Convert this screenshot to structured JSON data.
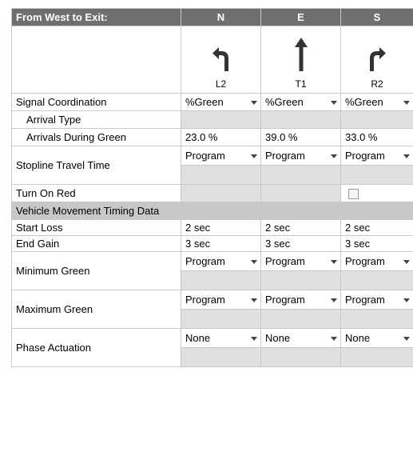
{
  "header": {
    "title": "From West to Exit:",
    "directions": [
      "N",
      "E",
      "S"
    ]
  },
  "movements": [
    {
      "label": "L2",
      "icon": "turn-left-arrow-icon"
    },
    {
      "label": "T1",
      "icon": "through-arrow-icon"
    },
    {
      "label": "R2",
      "icon": "turn-right-arrow-icon"
    }
  ],
  "rows": {
    "signal_coordination": {
      "label": "Signal Coordination",
      "values": [
        "%Green",
        "%Green",
        "%Green"
      ]
    },
    "arrival_type": {
      "label": "Arrival Type"
    },
    "arrivals_during_green": {
      "label": "Arrivals During Green",
      "values": [
        "23.0 %",
        "39.0 %",
        "33.0 %"
      ]
    },
    "stopline_travel_time": {
      "label": "Stopline Travel Time",
      "values": [
        "Program",
        "Program",
        "Program"
      ]
    },
    "turn_on_red": {
      "label": "Turn On Red"
    },
    "section_title": "Vehicle Movement Timing Data",
    "start_loss": {
      "label": "Start Loss",
      "values": [
        "2 sec",
        "2 sec",
        "2 sec"
      ]
    },
    "end_gain": {
      "label": "End Gain",
      "values": [
        "3 sec",
        "3 sec",
        "3 sec"
      ]
    },
    "minimum_green": {
      "label": "Minimum Green",
      "values": [
        "Program",
        "Program",
        "Program"
      ]
    },
    "maximum_green": {
      "label": "Maximum Green",
      "values": [
        "Program",
        "Program",
        "Program"
      ]
    },
    "phase_actuation": {
      "label": "Phase Actuation",
      "values": [
        "None",
        "None",
        "None"
      ]
    }
  },
  "colors": {
    "header_bg": "#6f6f6f",
    "section_bg": "#c8c8c8",
    "disabled_cell_bg": "#e0e0e0",
    "border": "#c8c8c8"
  }
}
